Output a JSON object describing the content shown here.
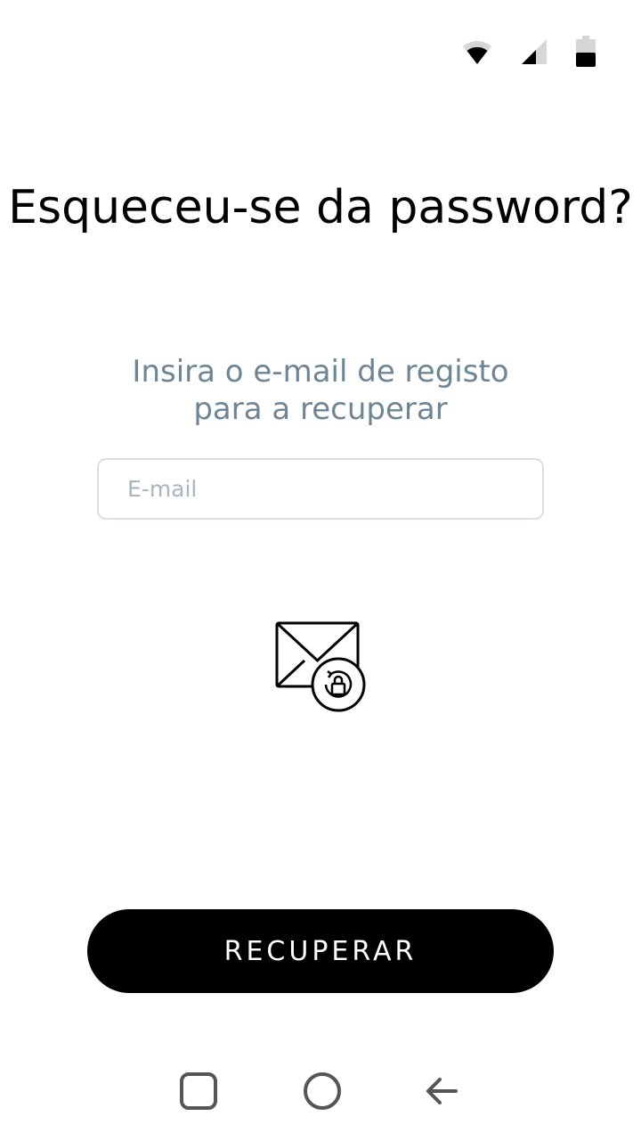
{
  "status_bar": {
    "icons": [
      "wifi-icon",
      "cell-signal-icon",
      "battery-icon"
    ]
  },
  "heading": {
    "title": "Esqueceu-se da password?"
  },
  "instructions": {
    "line1": "Insira o e-mail de registo",
    "line2": "para a recuperar"
  },
  "email": {
    "placeholder": "E-mail",
    "value": ""
  },
  "illustration": {
    "icon": "envelope-lock-reset-icon"
  },
  "actions": {
    "recover_label": "RECUPERAR"
  },
  "nav": {
    "buttons": [
      "recents-icon",
      "home-icon",
      "back-icon"
    ]
  },
  "colors": {
    "title": "#000000",
    "subtitle": "#6e8596",
    "button_bg": "#000000",
    "button_text": "#ffffff",
    "input_border": "#d9e0e5",
    "placeholder": "#a9b6c0"
  }
}
